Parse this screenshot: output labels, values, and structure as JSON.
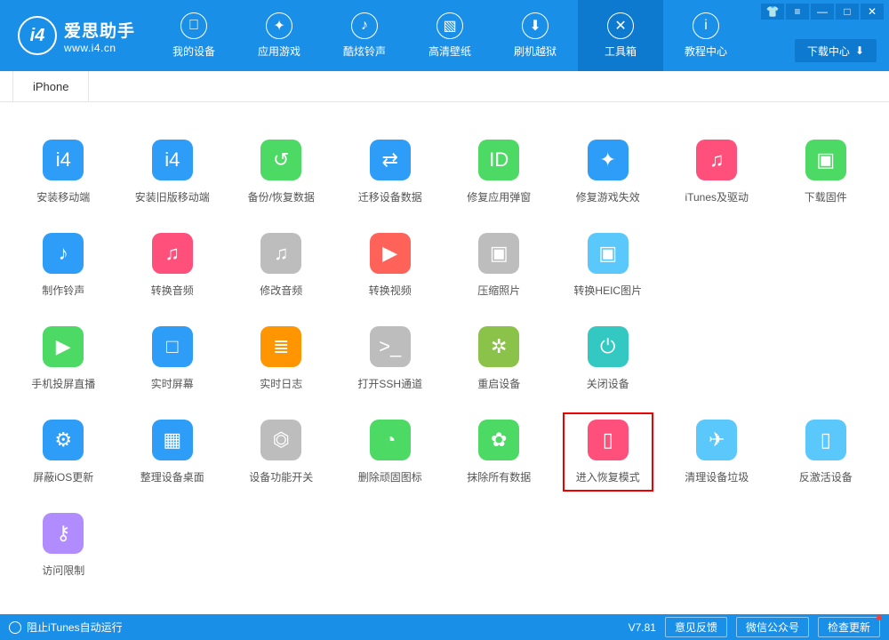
{
  "logo": {
    "badge": "i4",
    "cn": "爱思助手",
    "url": "www.i4.cn"
  },
  "nav": [
    {
      "label": "我的设备",
      "glyph": ""
    },
    {
      "label": "应用游戏",
      "glyph": "✦"
    },
    {
      "label": "酷炫铃声",
      "glyph": "♪"
    },
    {
      "label": "高清壁纸",
      "glyph": "▧"
    },
    {
      "label": "刷机越狱",
      "glyph": "⬇"
    },
    {
      "label": "工具箱",
      "glyph": "✕",
      "active": true
    },
    {
      "label": "教程中心",
      "glyph": "i"
    }
  ],
  "download_center": "下载中心",
  "tab": "iPhone",
  "tools": [
    {
      "label": "安装移动端",
      "bg": "bg-blue",
      "glyph": "i4"
    },
    {
      "label": "安装旧版移动端",
      "bg": "bg-blue",
      "glyph": "i4"
    },
    {
      "label": "备份/恢复数据",
      "bg": "bg-green",
      "glyph": "↺"
    },
    {
      "label": "迁移设备数据",
      "bg": "bg-blue",
      "glyph": "⇄"
    },
    {
      "label": "修复应用弹窗",
      "bg": "bg-green",
      "glyph": "ID"
    },
    {
      "label": "修复游戏失效",
      "bg": "bg-blue",
      "glyph": "✦"
    },
    {
      "label": "iTunes及驱动",
      "bg": "bg-pink",
      "glyph": "♫"
    },
    {
      "label": "下载固件",
      "bg": "bg-green",
      "glyph": "▣"
    },
    {
      "label": "制作铃声",
      "bg": "bg-blue",
      "glyph": "♪"
    },
    {
      "label": "转换音频",
      "bg": "bg-pink",
      "glyph": "♫"
    },
    {
      "label": "修改音频",
      "bg": "bg-gray",
      "glyph": "♫"
    },
    {
      "label": "转换视频",
      "bg": "bg-red",
      "glyph": "▶"
    },
    {
      "label": "压缩照片",
      "bg": "bg-gray",
      "glyph": "▣"
    },
    {
      "label": "转换HEIC图片",
      "bg": "bg-cyan",
      "glyph": "▣"
    },
    {
      "label": "",
      "bg": "",
      "glyph": ""
    },
    {
      "label": "",
      "bg": "",
      "glyph": ""
    },
    {
      "label": "手机投屏直播",
      "bg": "bg-green",
      "glyph": "▶"
    },
    {
      "label": "实时屏幕",
      "bg": "bg-blue",
      "glyph": "□"
    },
    {
      "label": "实时日志",
      "bg": "bg-orange",
      "glyph": "≣"
    },
    {
      "label": "打开SSH通道",
      "bg": "bg-gray",
      "glyph": ">_"
    },
    {
      "label": "重启设备",
      "bg": "bg-lime",
      "glyph": "✲"
    },
    {
      "label": "关闭设备",
      "bg": "bg-teal",
      "glyph": "⏻"
    },
    {
      "label": "",
      "bg": "",
      "glyph": ""
    },
    {
      "label": "",
      "bg": "",
      "glyph": ""
    },
    {
      "label": "屏蔽iOS更新",
      "bg": "bg-blue",
      "glyph": "⚙"
    },
    {
      "label": "整理设备桌面",
      "bg": "bg-blue",
      "glyph": "▦"
    },
    {
      "label": "设备功能开关",
      "bg": "bg-gray",
      "glyph": "⏣"
    },
    {
      "label": "删除顽固图标",
      "bg": "bg-green",
      "glyph": "◔"
    },
    {
      "label": "抹除所有数据",
      "bg": "bg-green",
      "glyph": "✿"
    },
    {
      "label": "进入恢复模式",
      "bg": "bg-pink",
      "glyph": "▯",
      "highlighted": true
    },
    {
      "label": "清理设备垃圾",
      "bg": "bg-cyan",
      "glyph": "✈"
    },
    {
      "label": "反激活设备",
      "bg": "bg-cyan",
      "glyph": "▯"
    },
    {
      "label": "访问限制",
      "bg": "bg-purp",
      "glyph": "⚷"
    }
  ],
  "footer": {
    "itunes": "阻止iTunes自动运行",
    "version": "V7.81",
    "btns": [
      "意见反馈",
      "微信公众号",
      "检查更新"
    ]
  }
}
